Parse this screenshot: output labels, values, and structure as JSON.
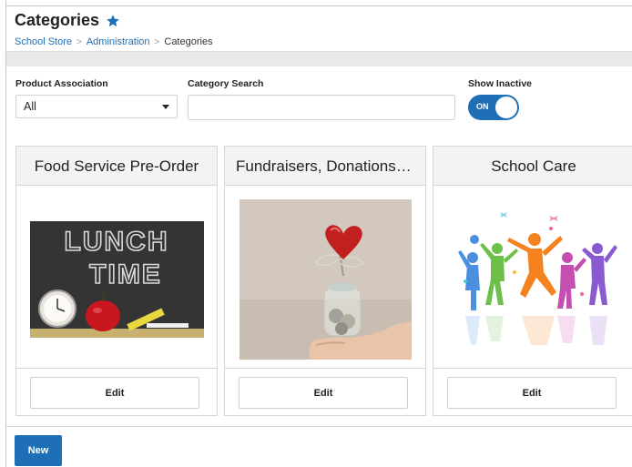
{
  "header": {
    "title": "Categories",
    "favorite_icon": "star-icon",
    "breadcrumb": [
      {
        "label": "School Store"
      },
      {
        "label": "Administration"
      },
      {
        "label": "Categories"
      }
    ],
    "breadcrumb_separator": ">"
  },
  "filters": {
    "product_association": {
      "label": "Product Association",
      "value": "All"
    },
    "category_search": {
      "label": "Category Search",
      "value": "",
      "placeholder": ""
    },
    "show_inactive": {
      "label": "Show Inactive",
      "state_label": "ON"
    }
  },
  "cards": [
    {
      "title": "Food Service Pre-Order",
      "image": "lunch-time-image",
      "image_text": "LUNCH TIME",
      "edit_label": "Edit"
    },
    {
      "title": "Fundraisers, Donations, and Service Fees",
      "image": "donation-jar-image",
      "edit_label": "Edit"
    },
    {
      "title": "School Care",
      "image": "children-jumping-image",
      "edit_label": "Edit"
    }
  ],
  "footer": {
    "new_label": "New"
  },
  "colors": {
    "accent": "#1e6fb5",
    "band": "#e9e9e9",
    "card_header": "#f3f3f3"
  }
}
